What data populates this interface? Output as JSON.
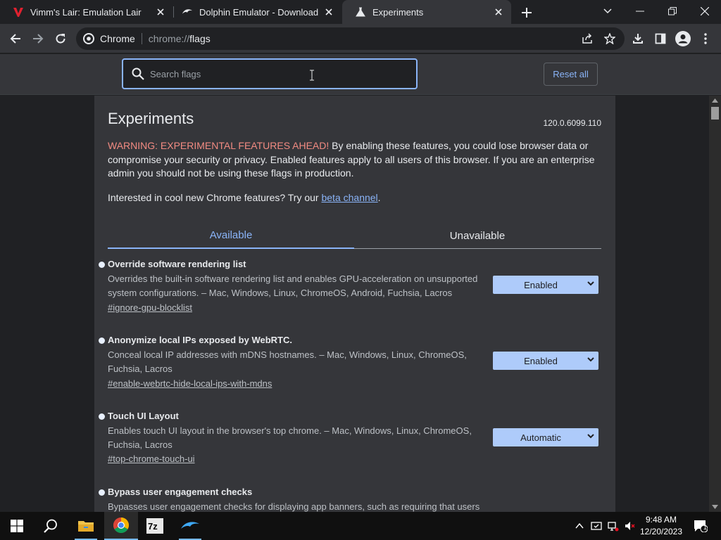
{
  "tabs": [
    {
      "title": "Vimm's Lair: Emulation Lair",
      "favicon": "vimm-v-icon",
      "active": false
    },
    {
      "title": "Dolphin Emulator - Download",
      "favicon": "dolphin-icon",
      "active": false
    },
    {
      "title": "Experiments",
      "favicon": "flask-icon",
      "active": true
    }
  ],
  "omnibox": {
    "site_label": "Chrome",
    "url_scheme": "chrome://",
    "url_path": "flags"
  },
  "flags_header": {
    "search_placeholder": "Search flags",
    "reset_label": "Reset all"
  },
  "page": {
    "title": "Experiments",
    "version": "120.0.6099.110",
    "warning_red": "WARNING: EXPERIMENTAL FEATURES AHEAD!",
    "warning_text": " By enabling these features, you could lose browser data or compromise your security or privacy. Enabled features apply to all users of this browser. If you are an enterprise admin you should not be using these flags in production.",
    "interested_prefix": "Interested in cool new Chrome features? Try our ",
    "interested_link": "beta channel",
    "interested_suffix": ".",
    "tab_available": "Available",
    "tab_unavailable": "Unavailable"
  },
  "flags": [
    {
      "name": "Override software rendering list",
      "description": "Overrides the built-in software rendering list and enables GPU-acceleration on unsupported system configurations. – Mac, Windows, Linux, ChromeOS, Android, Fuchsia, Lacros",
      "link": "#ignore-gpu-blocklist",
      "value": "Enabled"
    },
    {
      "name": "Anonymize local IPs exposed by WebRTC.",
      "description": "Conceal local IP addresses with mDNS hostnames. – Mac, Windows, Linux, ChromeOS, Fuchsia, Lacros",
      "link": "#enable-webrtc-hide-local-ips-with-mdns",
      "value": "Enabled"
    },
    {
      "name": "Touch UI Layout",
      "description": "Enables touch UI layout in the browser's top chrome. – Mac, Windows, Linux, ChromeOS, Fuchsia, Lacros",
      "link": "#top-chrome-touch-ui",
      "value": "Automatic"
    },
    {
      "name": "Bypass user engagement checks",
      "description": "Bypasses user engagement checks for displaying app banners, such as requiring that users"
    }
  ],
  "taskbar": {
    "time": "9:48 AM",
    "date": "12/20/2023",
    "notification_count": "1",
    "pinned": [
      "windows-start-icon",
      "search-icon",
      "file-explorer-icon",
      "chrome-icon",
      "7zip-icon",
      "dolphin-icon"
    ]
  },
  "colors": {
    "accent": "#8ab4f8",
    "warning": "#f28b82",
    "select_bg": "#aecbfa"
  }
}
